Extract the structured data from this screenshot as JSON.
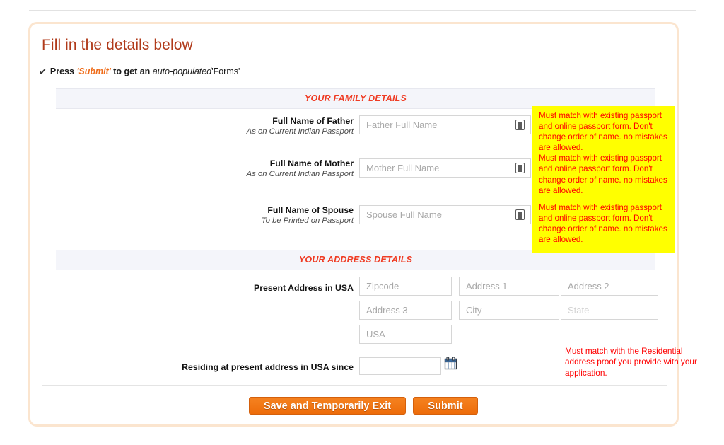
{
  "header": {
    "title": "Fill in the details below",
    "hint": {
      "check_icon": "check-icon",
      "press": "Press ",
      "submit_word": "'Submit'",
      "middle": " to get an ",
      "auto_populated": "auto-populated",
      "forms": "'Forms'"
    }
  },
  "sections": {
    "family": {
      "title": "YOUR FAMILY DETAILS"
    },
    "address": {
      "title": "YOUR ADDRESS DETAILS"
    }
  },
  "family_fields": [
    {
      "label": "Full Name of Father",
      "sublabel": "As on Current Indian Passport",
      "placeholder": "Father Full Name",
      "value": "",
      "icon": "passport-document-icon"
    },
    {
      "label": "Full Name of Mother",
      "sublabel": "As on Current Indian Passport",
      "placeholder": "Mother Full Name",
      "value": "",
      "icon": "passport-document-icon"
    },
    {
      "label": "Full Name of Spouse",
      "sublabel": "To be Printed on Passport",
      "placeholder": "Spouse Full Name",
      "value": "",
      "icon": "passport-document-icon"
    }
  ],
  "warning_box": {
    "background_color": "#ffff00",
    "text_color": "#ff0000",
    "blocks": [
      "Must match with existing passport and online passport form. Don't change order of name. no mistakes are allowed.",
      "Must match with existing passport and online passport form. Don't change order of name. no mistakes are allowed.",
      "Must match with existing passport and online passport form. Don't change order of name. no mistakes are allowed."
    ]
  },
  "address": {
    "label": "Present Address in USA",
    "fields": {
      "zipcode": {
        "placeholder": "Zipcode",
        "value": ""
      },
      "address1": {
        "placeholder": "Address 1",
        "value": ""
      },
      "address2": {
        "placeholder": "Address 2",
        "value": ""
      },
      "address3": {
        "placeholder": "Address 3",
        "value": ""
      },
      "city": {
        "placeholder": "City",
        "value": ""
      },
      "state": {
        "placeholder": "State",
        "value": ""
      },
      "country": {
        "placeholder": "USA",
        "value": "USA"
      }
    },
    "note": "Must match with the Residential address proof you provide with your application."
  },
  "residing": {
    "label": "Residing at present address in USA since",
    "placeholder": "",
    "value": "",
    "icon": "calendar-icon"
  },
  "buttons": {
    "save": "Save and Temporarily Exit",
    "submit": "Submit"
  },
  "colors": {
    "panel_border": "#fbe5cf",
    "title": "#b03a1a",
    "section_title": "#ef3b23",
    "button": "#ef6c1a",
    "warning_bg": "#ffff00",
    "warning_text": "#ff0000"
  }
}
